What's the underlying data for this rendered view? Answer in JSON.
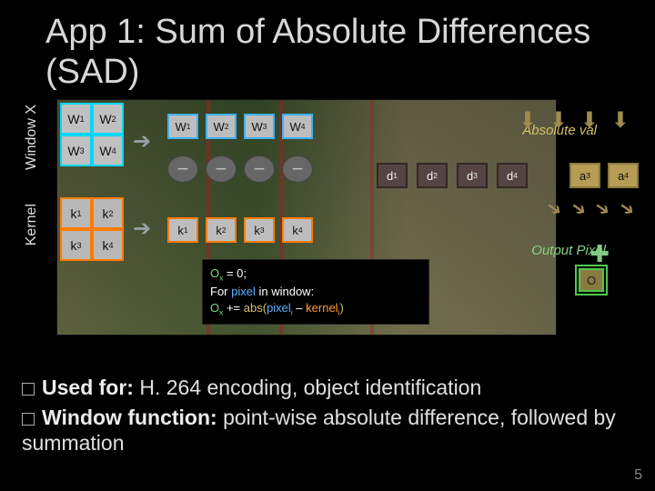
{
  "title": "App 1: Sum of Absolute Differences (SAD)",
  "side_labels": {
    "window_x": "Window X",
    "kernel": "Kernel"
  },
  "window_grid": [
    "W",
    "W",
    "W",
    "W"
  ],
  "window_sub": [
    "1",
    "2",
    "3",
    "4"
  ],
  "kernel_grid": [
    "k",
    "k",
    "k",
    "k"
  ],
  "kernel_sub": [
    "1",
    "2",
    "3",
    "4"
  ],
  "row_window": [
    "W",
    "W",
    "W",
    "W"
  ],
  "row_window_sub": [
    "1",
    "2",
    "3",
    "4"
  ],
  "row_kernel": [
    "k",
    "k",
    "k",
    "k"
  ],
  "row_kernel_sub": [
    "1",
    "2",
    "3",
    "4"
  ],
  "row_diff": [
    "d",
    "d",
    "d",
    "d"
  ],
  "row_diff_sub": [
    "1",
    "2",
    "3",
    "4"
  ],
  "row_abs": [
    "a",
    "a"
  ],
  "row_abs_sub": [
    "3",
    "4"
  ],
  "labels": {
    "abs_val": "Absolute val",
    "output_pixel": "Output Pixel"
  },
  "output_cell": "O",
  "code": {
    "l1a": "O",
    "l1b": " = 0;",
    "l2a": "For ",
    "l2b": "pixel",
    "l2c": " in window:",
    "l3a": "    O",
    "l3b": " += ",
    "l3c": "abs(",
    "l3d": "pixel",
    "l3e": " – ",
    "l3f": "kernel",
    "l3g": ")",
    "sub_x": "x",
    "sub_i1": "i",
    "sub_i2": "i"
  },
  "bullets": {
    "b1_bold": "Used for:",
    "b1_rest": " H. 264 encoding, object identification",
    "b2_bold": "Window function:",
    "b2_rest": " point-wise absolute difference, followed by summation"
  },
  "page_number": "5"
}
